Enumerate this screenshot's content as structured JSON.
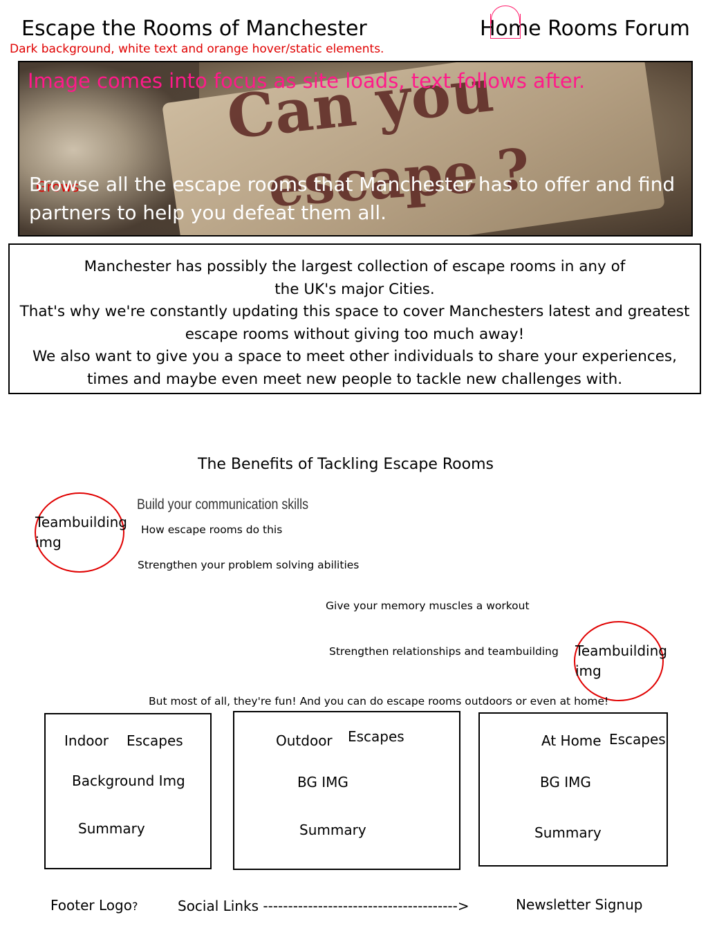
{
  "header": {
    "title": "Escape the Rooms of Manchester",
    "nav": [
      "Home",
      "Rooms",
      "Forum"
    ],
    "design_note": "Dark background, white text and orange hover/static elements."
  },
  "hero": {
    "caption": "Image comes into focus as site loads, text follows after.",
    "image_text_line1": "Can you",
    "image_text_line2": "escape ?",
    "red_note": "Grows",
    "text": "Browse all the escape rooms that Manchester has to offer and find partners to help you defeat them all."
  },
  "intro": {
    "lines": [
      "Manchester has possibly the largest collection of escape rooms in any of",
      "the UK's major Cities.",
      "That's why we're constantly updating this space to cover Manchesters latest and greatest",
      "escape rooms without giving too much away!",
      "We also want to give you a space to meet other individuals to share your experiences,",
      "times and maybe even meet new people to tackle new challenges with."
    ]
  },
  "benefits": {
    "title": "The Benefits of Tackling Escape Rooms",
    "img1_label": "Teambuilding img",
    "img2_label": "Teambuilding img",
    "heading": "Build your communication skills",
    "sub": "How escape rooms do this",
    "item2": "Strengthen your problem solving abilities",
    "item3": "Give your memory muscles a workout",
    "item4": "Strengthen relationships and teambuilding",
    "closing": "But most of all, they're fun! And you can do escape rooms outdoors or even at home!"
  },
  "categories": [
    {
      "name": "Indoor",
      "suffix": "Escapes",
      "bg": "Background Img",
      "summary": "Summary"
    },
    {
      "name": "Outdoor",
      "suffix": "Escapes",
      "bg": "BG IMG",
      "summary": "Summary"
    },
    {
      "name": "At Home",
      "suffix": "Escapes",
      "bg": "BG IMG",
      "summary": "Summary"
    }
  ],
  "footer": {
    "logo": "Footer Logo",
    "logo_q": "?",
    "social": "Social Links --------------------------------------->",
    "newsletter": "Newsletter Signup"
  },
  "colors": {
    "annotation_red": "#e00000",
    "annotation_pink": "#ff1a8a"
  }
}
